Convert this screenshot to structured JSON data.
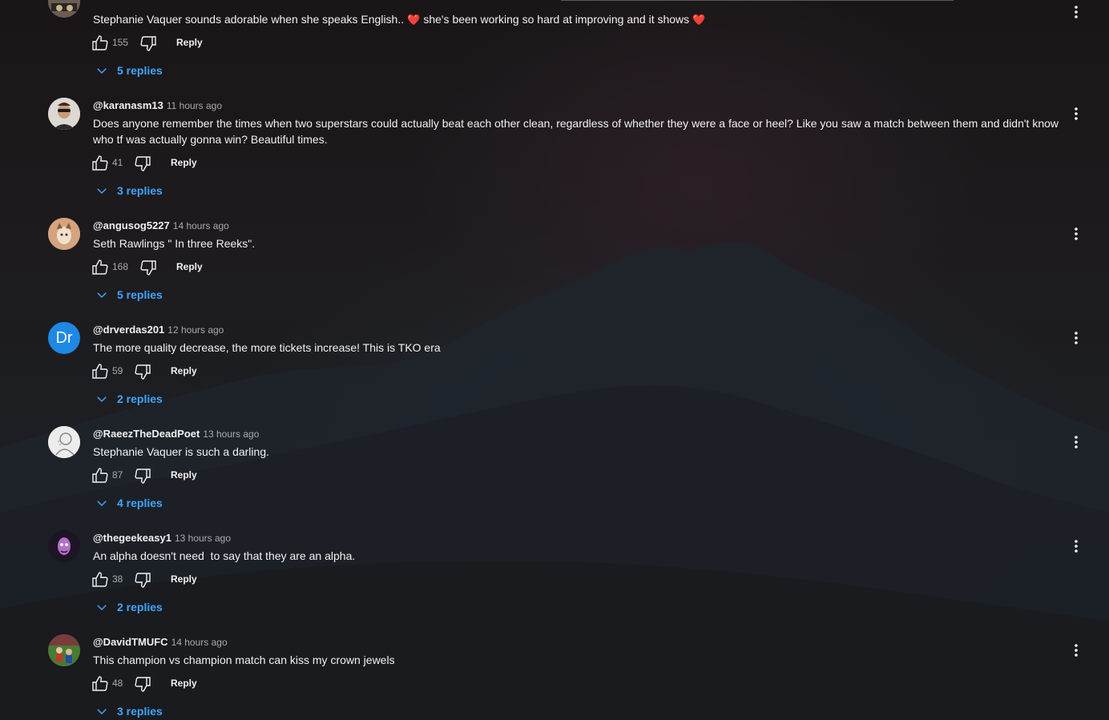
{
  "colors": {
    "accent": "#3ea6ff",
    "heart": "#e0245e",
    "muted": "#aaaaaa",
    "text": "#f1f1f1"
  },
  "comments": [
    {
      "author": "",
      "time": "",
      "avatar": "avatar-wrestler",
      "text_a": "Stephanie Vaquer sounds adorable when she speaks English..",
      "text_b": "she's been working so hard at improving and it shows",
      "likes": "155",
      "reply_label": "Reply",
      "replies_label": "5 replies"
    },
    {
      "author": "@karanasm13",
      "time": "11 hours ago",
      "avatar": "avatar-man-sunglasses",
      "text": "Does anyone remember the times when two superstars could actually beat each other clean, regardless of whether they were a face or heel? Like you saw a match between them and didn't know who tf was actually gonna win? Beautiful times.",
      "likes": "41",
      "reply_label": "Reply",
      "replies_label": "3 replies"
    },
    {
      "author": "@angusog5227",
      "time": "14 hours ago",
      "avatar": "avatar-cartoon",
      "text": "Seth Rawlings \" In three Reeks\".",
      "likes": "168",
      "reply_label": "Reply",
      "replies_label": "5 replies"
    },
    {
      "author": "@drverdas201",
      "time": "12 hours ago",
      "avatar_initials": "Dr",
      "text": "The more quality decrease, the more tickets increase! This is TKO era",
      "likes": "59",
      "reply_label": "Reply",
      "replies_label": "2 replies"
    },
    {
      "author": "@RaeezTheDeadPoet",
      "time": "13 hours ago",
      "avatar": "avatar-sketch",
      "text": "Stephanie Vaquer is such a darling.",
      "likes": "87",
      "reply_label": "Reply",
      "replies_label": "4 replies"
    },
    {
      "author": "@thegeekeasy1",
      "time": "13 hours ago",
      "avatar": "avatar-dark-face",
      "text": "An alpha doesn't need  to say that they are an alpha.",
      "likes": "38",
      "reply_label": "Reply",
      "replies_label": "2 replies"
    },
    {
      "author": "@DavidTMUFC",
      "time": "14 hours ago",
      "avatar": "avatar-football",
      "text": "This champion vs champion match can kiss my crown jewels",
      "likes": "48",
      "reply_label": "Reply",
      "replies_label": "3 replies"
    }
  ]
}
